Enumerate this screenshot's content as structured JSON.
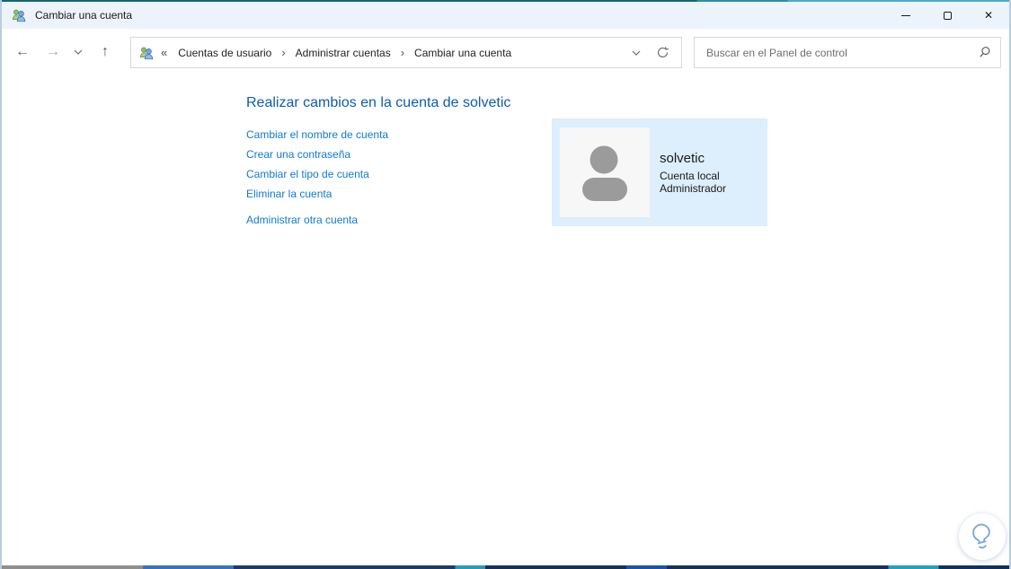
{
  "window": {
    "title": "Cambiar una cuenta"
  },
  "icons": {
    "back": "←",
    "forward": "→",
    "up": "↑",
    "close": "✕"
  },
  "toolbar": {
    "breadcrumb": {
      "overflow": "«",
      "separator": "›",
      "items": [
        "Cuentas de usuario",
        "Administrar cuentas",
        "Cambiar una cuenta"
      ]
    },
    "search": {
      "placeholder": "Buscar en el Panel de control"
    }
  },
  "main": {
    "heading": "Realizar cambios en la cuenta de solvetic",
    "links": [
      "Cambiar el nombre de cuenta",
      "Crear una contraseña",
      "Cambiar el tipo de cuenta",
      "Eliminar la cuenta"
    ],
    "manage_other_link": "Administrar otra cuenta",
    "account_card": {
      "name": "solvetic",
      "account_kind": "Cuenta local",
      "account_role": "Administrador"
    }
  },
  "colors": {
    "heading_blue": "#0e5cad",
    "link_blue": "#0f7ad2",
    "titlebar_bg": "#ecf3fb",
    "card_bg": "#ddeefc",
    "avatar_gray": "#9b9b9b",
    "window_border": "#b9cce0"
  }
}
